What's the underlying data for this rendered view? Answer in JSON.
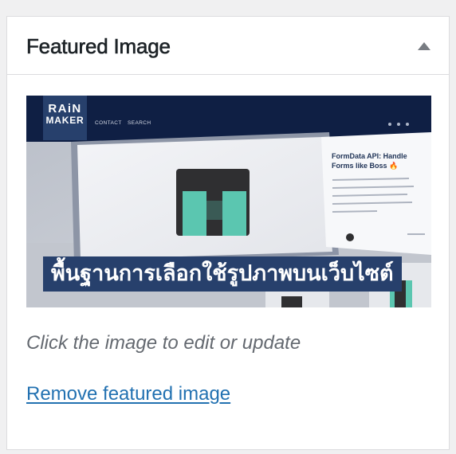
{
  "panel": {
    "title": "Featured Image",
    "toggle_icon": "caret-up-icon"
  },
  "thumbnail": {
    "brand_line1": "RAiN",
    "brand_line2": "MAKER",
    "nav_contact": "CONTACT",
    "nav_search": "SEARCH",
    "side_card_title": "FormData API: Handle Forms like Boss 🔥",
    "caption": "พื้นฐานการเลือกใช้รูปภาพบนเว็บไซต์",
    "colors": {
      "navy": "#0f1f44",
      "brand_blue": "#27406c",
      "teal": "#5bc6b0",
      "dark": "#2f2f31"
    }
  },
  "hint_text": "Click the image to edit or update",
  "remove_link": "Remove featured image",
  "colors": {
    "link": "#2271b1",
    "hint": "#646970",
    "title": "#1d2327",
    "border": "#dcdcde"
  }
}
